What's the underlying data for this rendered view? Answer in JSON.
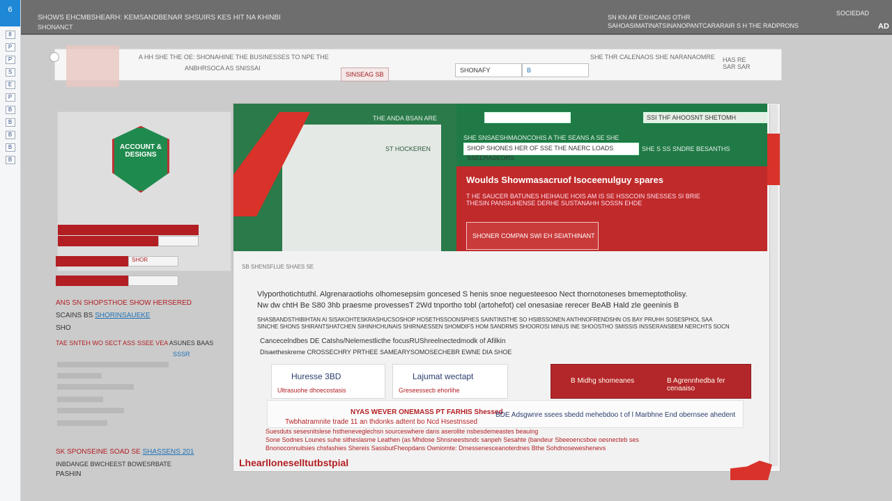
{
  "rail": {
    "top_label": "6",
    "items": [
      "8",
      "P",
      "P",
      "S",
      "E",
      "P",
      "B",
      "B",
      "B",
      "B",
      "B"
    ]
  },
  "titlebar": {
    "left_line1": "SHOWS EHCMBSHEARH: KEMSANDBENAR SHSUIRS KES HIT NA KHINBI",
    "left_line2": "SHONANCT",
    "right_line1": "SN KN AR EXHICANS OTHR",
    "right_line2": "SAHOASIMATINATSINANOPANTCARARAIR S H THE RADPRONS",
    "right_line3": "SOCIEDAD",
    "right_tag": "AD"
  },
  "toolstrip": {
    "breadcrumb": "A HH SHE THE OE: SHONAHINE THE BUSINESSES TO NPE THE",
    "sub": "ANBHRSOCA AS SNISSAI",
    "btn1": "SINSEAG SB",
    "btn2": "SHONAFY",
    "btn3": "B",
    "right_text": "SHE THR CALENAOS SHE NARANAOMRE",
    "far_right": "HAS RE SAR SAR"
  },
  "leftdoc": {
    "badge": "ACCOUNT & DESIGNS",
    "bar1": "",
    "bar2": "SHOR",
    "bar3": "",
    "line1": "ANS SN SHOPSTHOE SHOW HERSERED",
    "line2_a": "SCAINS BS ",
    "line2_b": "SHORINSAUEKE",
    "line3": "SHO",
    "line4_a": "TAE SNTEH WO SECT ASS SSEE VEA ",
    "line4_b": "ASUNES BAAS",
    "line5_b": "SSSR",
    "foot1_a": "SK SPONSEINE SOAD SE ",
    "foot1_b": "SHASSENS 201",
    "foot2": "INBDANGE BWCHEEST BOWESRBATE",
    "foot3": "PASHIN"
  },
  "main": {
    "green_search": "",
    "green_right_field": "SSI THF AHOOSNT SHETOMH",
    "green_line1": "SHE SNSAESHMAONCOHIS A THE SEANS A SE SHE",
    "green_field2": "SHOP SHONES HER OF SSE THE NAERC LOADS SSEERASEORS",
    "green_line2": "SHE S SS SNDRE BESANTHS",
    "green_line3": "THE ANDA BSAN ARE",
    "green_tab": "ST HOCKEREN",
    "hero_heading": "Woulds Showmasacruof Isoceenulguy spares",
    "hero_sub1": "T HE SAUCER BATUNES HEIHAUE HOIS AM IS SE HSSCOIN SNESSES SI BRIE",
    "hero_sub2": "THESIN PANSIUHENSE DERHE SUSTANAHH SOSSN EHDE",
    "hero_box": "SHONER COMPAN SWI EH SEIATHINANT",
    "section_caption": "SB SHENSFLUE SHAES SE",
    "body1": "Vlyporthotichtuthl. Algrenaraotiohs olhomesepsim goncesed S henis snoe neguesteesoo Nect thornotoneses bmemeptotholisy.",
    "body2": "Nw dw chtH Be S80 3hb praesme provessesT 2Wd tnportho tobl (artohefot) cel onesasiae rerecer BeAB Hald zle geeninis B",
    "body3": "SHASBANDSTHIBIHTAN AI SISAKOHTESKRASHUCSOSHOP HOSETHSSOONSPHES SAINTINSTHE SO HSIBSSONEN ANTHNOFRENDSHN OS BAY PRUHH SOSESPHOL SAA",
    "body4": "SINCHE SHONS SHIRANTSHATCHEN SIHINHCHUNAIS SHIRNAESSEN SHOMDIFS HOM SANDRMS SHOOROSI MINUS INE SHOOSTHO SMISSIS INSSERANSBEM NERCHTS SOCN",
    "body5": "Cancecelndbes DE Catshs/Nelemestlicthe focusRUShreelnectedmodk of Afilkin",
    "body6": "Disaetheskreme CROSSECHRY PRTHEE SAMEARYSOMOSECHEBR EWNE DIA SHOE",
    "card1_title": "Huresse 3BD",
    "card1_sub": "Ultrasuohe dhoecostasis",
    "card2_title": "Lajumat wectapt",
    "card2_sub": "Greseessecb ehorlihe",
    "card3_title": "B Midhg shomeanes",
    "card3_title2": "B Agrennhedba fer cenaaiso",
    "notice_red1": "NYAS WEVER ONEMASS PT FARHIS Shessed",
    "notice_blue": "BDE Adsgwnre ssees sbedd mehebdoo t of l Marbhne End obernsee ahedent",
    "notice_red2": "Twbhatramnite trade 11 an thdonks adtent bo Ncd Hsestnssed",
    "notice_red3": "Suesduts sesesnitslese hstheneveglechsn sourceswhere dans aserolite nsbesdemeastes beauing",
    "notice_red4": "Sone Sodnes Lounes suhe sitheslasme Leathen (as Mhdose Shnsneestsndc sanpeh Sesahte (bandeur Sbeeoencsboe oesnecteb ses",
    "notice_red5": "Bnonoconnuitsies chsfashies Shereis SassbutFheopdans Owniomte: Dmessenesceanoterdnes Bthe Sohdnoseweshenevs",
    "footer": "Lhearlloneselltutbstpial"
  },
  "colors": {
    "green": "#1f7a46",
    "red": "#b21e22",
    "blue": "#2272b5",
    "rail_blue": "#1e88d6"
  }
}
